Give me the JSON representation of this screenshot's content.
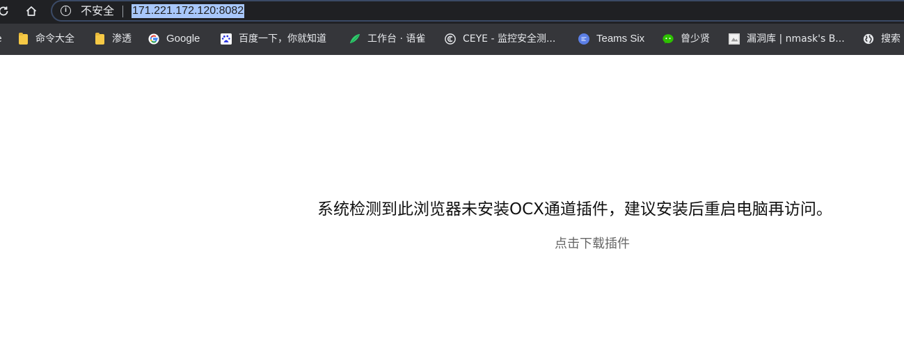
{
  "toolbar": {
    "reload_icon": "reload-icon",
    "home_icon": "home-icon",
    "security_label": "不安全",
    "url": "171.221.172.120:8082"
  },
  "bookmarks": [
    {
      "label": "命令大全",
      "icon": "folder-icon"
    },
    {
      "label": "渗透",
      "icon": "folder-icon"
    },
    {
      "label": "Google",
      "icon": "google-icon"
    },
    {
      "label": "百度一下，你就知道",
      "icon": "baidu-icon"
    },
    {
      "label": "工作台 · 语雀",
      "icon": "yuque-icon"
    },
    {
      "label": "CEYE - 监控安全测...",
      "icon": "ceye-icon"
    },
    {
      "label": "Teams Six",
      "icon": "teams-six-icon"
    },
    {
      "label": "曾少贤",
      "icon": "wechat-icon"
    },
    {
      "label": "漏洞库 | nmask's B...",
      "icon": "page-thumbnail-icon"
    },
    {
      "label": "搜索",
      "icon": "globe-icon"
    }
  ],
  "page": {
    "message": "系统检测到此浏览器未安装OCX通道插件，建议安装后重启电脑再访问。",
    "download_link": "点击下载插件"
  },
  "colors": {
    "toolbar_bg": "#202124",
    "bookmarks_bg": "#35363a",
    "url_highlight": "#a8c7fa",
    "message_text": "#111111",
    "link_text": "#666666"
  }
}
